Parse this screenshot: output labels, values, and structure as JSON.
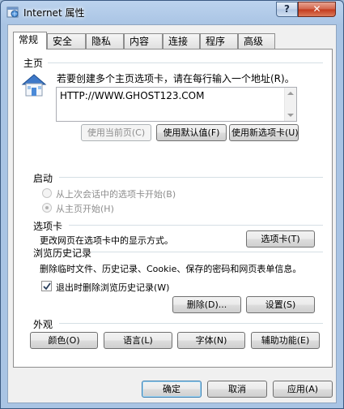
{
  "window": {
    "title": "Internet 属性",
    "help_label": "?",
    "close_label": "✕"
  },
  "tabs": [
    {
      "label": "常规",
      "active": true
    },
    {
      "label": "安全"
    },
    {
      "label": "隐私"
    },
    {
      "label": "内容"
    },
    {
      "label": "连接"
    },
    {
      "label": "程序"
    },
    {
      "label": "高级"
    }
  ],
  "home": {
    "title": "主页",
    "description": "若要创建多个主页选项卡，请在每行输入一个地址(R)。",
    "url": "HTTP://WWW.GHOST123.COM",
    "use_current": "使用当前页(C)",
    "use_default": "使用默认值(F)",
    "use_new_tab": "使用新选项卡(U)"
  },
  "startup": {
    "title": "启动",
    "option_last_session": "从上次会话中的选项卡开始(B)",
    "option_home": "从主页开始(H)",
    "selected": "option_home"
  },
  "tabs_section": {
    "title": "选项卡",
    "description": "更改网页在选项卡中的显示方式。",
    "button": "选项卡(T)"
  },
  "history": {
    "title": "浏览历史记录",
    "description": "删除临时文件、历史记录、Cookie、保存的密码和网页表单信息。",
    "checkbox_label": "退出时删除浏览历史记录(W)",
    "checkbox_checked": true,
    "delete_button": "删除(D)...",
    "settings_button": "设置(S)"
  },
  "appearance": {
    "title": "外观",
    "colors": "颜色(O)",
    "languages": "语言(L)",
    "fonts": "字体(N)",
    "accessibility": "辅助功能(E)"
  },
  "footer": {
    "ok": "确定",
    "cancel": "取消",
    "apply": "应用(A)"
  }
}
